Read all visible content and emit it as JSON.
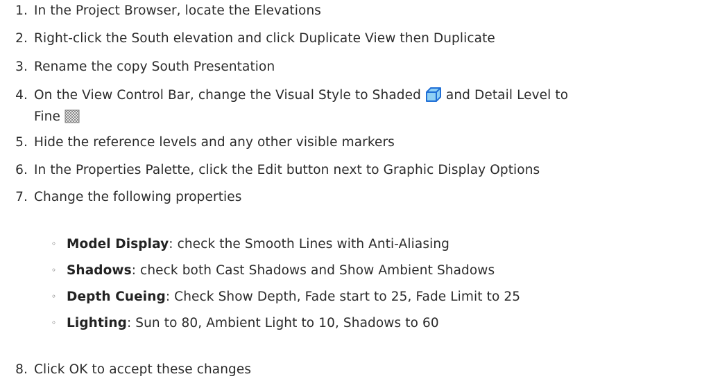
{
  "steps": [
    {
      "num": "1.",
      "text": "In the Project Browser, locate the Elevations"
    },
    {
      "num": "2.",
      "text": "Right-click the South elevation and click Duplicate View then Duplicate"
    },
    {
      "num": "3.",
      "text": "Rename the copy South Presentation"
    },
    {
      "num": "4.",
      "text_a": "On the View Control Bar, change the Visual Style to Shaded",
      "text_b": "and Detail Level to",
      "text_c": "Fine"
    },
    {
      "num": "5.",
      "text": "Hide the reference levels and any other visible markers"
    },
    {
      "num": "6.",
      "text": "In the Properties Palette, click the Edit button next to Graphic Display Options"
    },
    {
      "num": "7.",
      "text": "Change the following properties"
    },
    {
      "num": "8.",
      "text": "Click OK to accept these changes"
    }
  ],
  "bullet_char": "◦",
  "properties": [
    {
      "label": "Model Display",
      "text": ": check the Smooth Lines with Anti-Aliasing"
    },
    {
      "label": "Shadows",
      "text": ": check both Cast Shadows and Show Ambient Shadows"
    },
    {
      "label": "Depth Cueing",
      "text": ": Check Show Depth, Fade start to 25, Fade Limit to 25"
    },
    {
      "label": "Lighting",
      "text": ": Sun to 80, Ambient Light to 10, Shadows to 60"
    }
  ],
  "icons": {
    "shaded": "shaded-visual-style-icon",
    "fine": "fine-detail-level-icon",
    "shaded_color": "#1f6fd6",
    "shaded_fill": "#8fd0f4"
  }
}
